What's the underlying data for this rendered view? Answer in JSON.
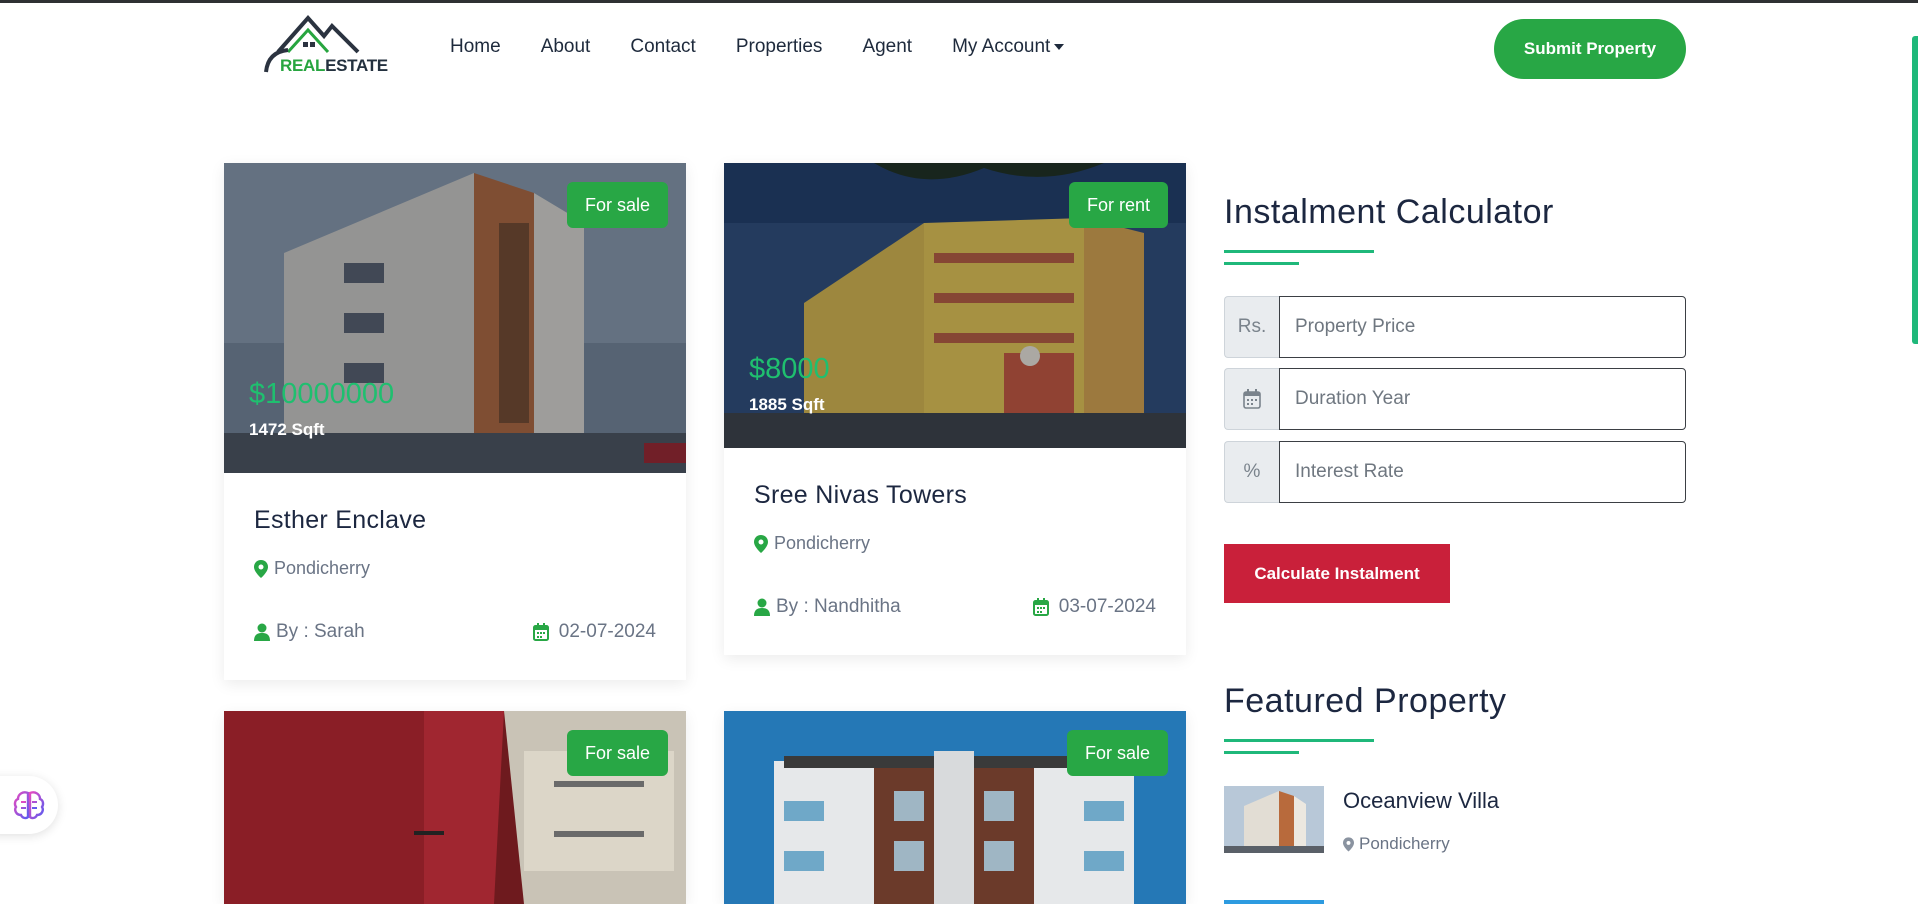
{
  "brand": {
    "logo_text_a": "REAL",
    "logo_text_b": "ESTATE"
  },
  "nav": {
    "items": [
      "Home",
      "About",
      "Contact",
      "Properties",
      "Agent",
      "My Account"
    ],
    "submit_label": "Submit Property"
  },
  "listings": [
    {
      "badge": "For sale",
      "price": "$10000000",
      "area": "1472 Sqft",
      "title": "Esther Enclave",
      "location": "Pondicherry",
      "by": "By : Sarah",
      "date": "02-07-2024"
    },
    {
      "badge": "For rent",
      "price": "$8000",
      "area": "1885 Sqft",
      "title": "Sree Nivas Towers",
      "location": "Pondicherry",
      "by": "By : Nandhitha",
      "date": "03-07-2024"
    },
    {
      "badge": "For sale"
    },
    {
      "badge": "For sale"
    }
  ],
  "calculator": {
    "title": "Instalment Calculator",
    "price_addon": "Rs.",
    "price_placeholder": "Property Price",
    "duration_placeholder": "Duration Year",
    "rate_addon": "%",
    "rate_placeholder": "Interest Rate",
    "button_label": "Calculate Instalment"
  },
  "featured": {
    "title": "Featured Property",
    "items": [
      {
        "title": "Oceanview Villa",
        "location": "Pondicherry"
      }
    ]
  },
  "colors": {
    "primary_green": "#28a745",
    "accent_teal": "#1fb87a",
    "calc_red": "#c9203a"
  },
  "icons": [
    "map-pin-icon",
    "user-icon",
    "calendar-icon",
    "brain-icon"
  ]
}
